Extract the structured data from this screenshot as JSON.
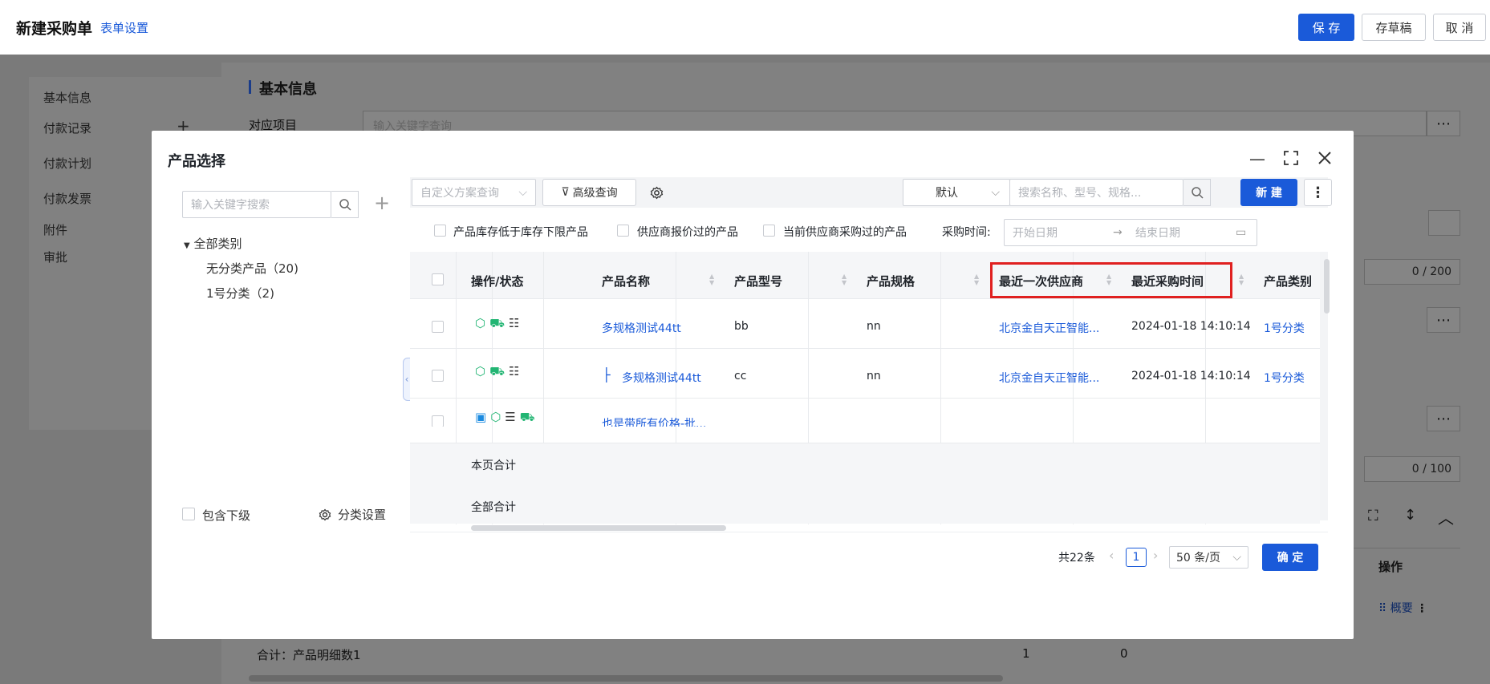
{
  "page": {
    "title": "新建采购单",
    "form_settings": "表单设置",
    "save": "保 存",
    "draft": "存草稿",
    "cancel": "取 消"
  },
  "left_nav": [
    "基本信息",
    "付款记录",
    "付款计划",
    "付款发票",
    "附件",
    "审批"
  ],
  "form": {
    "section_title": "基本信息",
    "field_label": "对应项目",
    "field_placeholder": "输入关键字查询",
    "count1": "0 / 200",
    "count2": "0 / 100",
    "col_action": "操作",
    "row_action": "概要",
    "summary": "合计：产品明细数1",
    "sum1": "1",
    "sum2": "0"
  },
  "dialog": {
    "title": "产品选择",
    "tree_search_placeholder": "输入关键字搜索",
    "tree_root": "全部类别",
    "tree_items": [
      "无分类产品（20)",
      "1号分类（2)"
    ],
    "include_sub": "包含下级",
    "category_settings": "分类设置",
    "scheme_placeholder": "自定义方案查询",
    "advanced_query": "高级查询",
    "sort_default": "默认",
    "search_placeholder": "搜索名称、型号、规格...",
    "new_button": "新 建",
    "filters": [
      "产品库存低于库存下限产品",
      "供应商报价过的产品",
      "当前供应商采购过的产品"
    ],
    "purchase_time_label": "采购时间:",
    "start_date": "开始日期",
    "end_date": "结束日期",
    "columns": [
      "操作/状态",
      "产品名称",
      "产品型号",
      "产品规格",
      "最近一次供应商",
      "最近采购时间",
      "产品类别"
    ],
    "rows": [
      {
        "name": "多规格测试44tt",
        "model": "bb",
        "spec": "nn",
        "supplier": "北京金自天正智能...",
        "time": "2024-01-18 14:10:14",
        "category": "1号分类"
      },
      {
        "name": "多规格测试44tt",
        "model": "cc",
        "spec": "nn",
        "supplier": "北京金自天正智能...",
        "time": "2024-01-18 14:10:14",
        "category": "1号分类"
      },
      {
        "name": "也是带所有价格-批...",
        "model": "",
        "spec": "",
        "supplier": "",
        "time": "",
        "category": ""
      }
    ],
    "page_total_label": "本页合计",
    "all_total_label": "全部合计",
    "pagination": {
      "total": "共22条",
      "current": "1",
      "page_size": "50 条/页"
    },
    "confirm": "确 定"
  },
  "colors": {
    "primary": "#1a5ad9",
    "highlight_border": "#e02020",
    "icon_green": "#22b573"
  }
}
